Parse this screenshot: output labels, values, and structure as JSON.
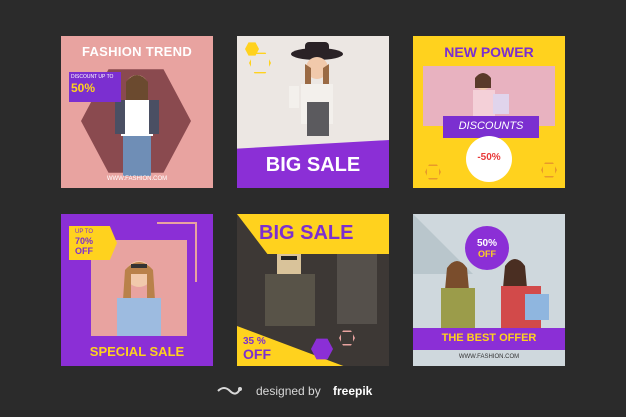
{
  "cards": {
    "fashion_trend": {
      "title": "FASHION TREND",
      "badge_label": "DISCOUNT UP TO",
      "badge_value": "50%",
      "website": "WWW.FASHION.COM"
    },
    "big_sale_1": {
      "headline": "BIG SALE"
    },
    "new_power": {
      "title": "NEW POWER",
      "discount_label": "DISCOUNTS",
      "discount_value": "-50%"
    },
    "special_sale": {
      "badge_line1": "UP TO",
      "badge_line2": "70%",
      "badge_line3": "OFF",
      "headline": "SPECIAL SALE"
    },
    "big_sale_2": {
      "headline": "BIG SALE",
      "off_line1": "35 %",
      "off_line2": "OFF"
    },
    "best_offer": {
      "badge_line1": "50%",
      "badge_line2": "OFF",
      "headline": "THE BEST OFFER",
      "website": "WWW.FASHION.COM"
    }
  },
  "footer": {
    "via": "designed by",
    "brand": "freepik"
  },
  "colors": {
    "background": "#2b2b2b",
    "purple": "#8b2fd6",
    "yellow": "#ffd21e",
    "pink": "#e8a3a0"
  }
}
